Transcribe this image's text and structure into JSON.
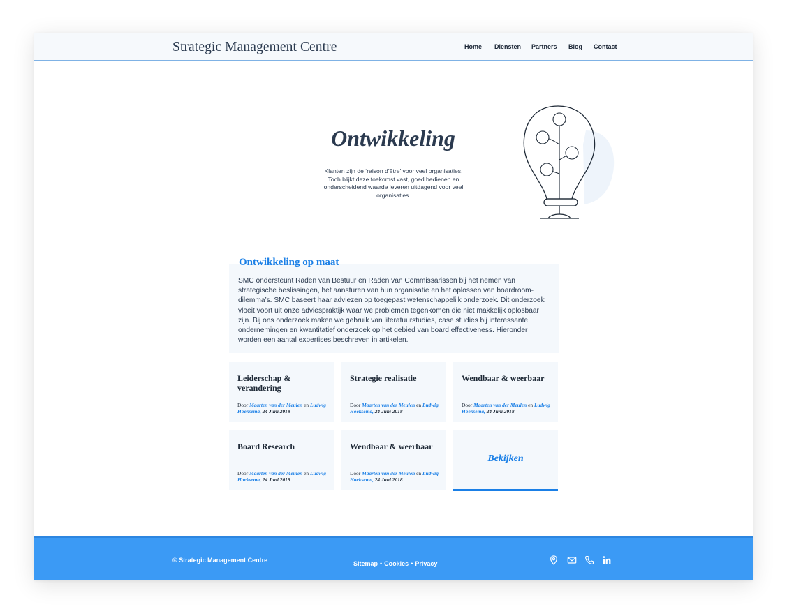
{
  "header": {
    "brand": "Strategic Management Centre",
    "nav": [
      "Home",
      "Diensten",
      "Partners",
      "Blog",
      "Contact"
    ]
  },
  "hero": {
    "title": "Ontwikkeling",
    "text": "Klanten zijn de ‘raison d’être’ voor veel organisaties. Toch blijkt deze toekomst vast, goed bedienen en onderscheidend waarde leveren uitdagend voor veel organisaties.",
    "illustration": "lightbulb-tree-icon"
  },
  "intro": {
    "heading": "Ontwikkeling op maat",
    "text": "SMC ondersteunt Raden van Bestuur en Raden van Commissarissen bij het nemen van strategische beslissingen, het aansturen van hun organisatie en het oplossen van boardroom-dilemma’s. SMC baseert haar adviezen op toegepast wetenschappelijk onderzoek. Dit onderzoek vloeit voort uit onze adviespraktijk waar we problemen tegenkomen die niet makkelijk oplosbaar zijn. Bij ons onderzoek maken we gebruik van literatuurstudies, case studies bij interessante ondernemingen en kwantitatief onderzoek op het gebied van board effectiveness. Hieronder worden een aantal expertises beschreven in artikelen."
  },
  "cards": [
    {
      "title": "Leiderschap & verandering",
      "prefix": "Door",
      "author1": "Maarten van der Meulen",
      "conj": "en",
      "author2": "Ludwig Hoeksema,",
      "date": "24 Juni 2018"
    },
    {
      "title": "Strategie realisatie",
      "prefix": "Door",
      "author1": "Maarten van der Meulen",
      "conj": "en",
      "author2": "Ludwig Hoeksema,",
      "date": "24 Juni 2018"
    },
    {
      "title": "Wendbaar & weerbaar",
      "prefix": "Door",
      "author1": "Maarten van der Meulen",
      "conj": "en",
      "author2": "Ludwig Hoeksema,",
      "date": "24 Juni 2018"
    },
    {
      "title": "Board Research",
      "prefix": "Door",
      "author1": "Maarten van der Meulen",
      "conj": "en",
      "author2": "Ludwig Hoeksema,",
      "date": "24 Juni 2018"
    },
    {
      "title": "Wendbaar & weerbaar",
      "prefix": "Door",
      "author1": "Maarten van der Meulen",
      "conj": "en",
      "author2": "Ludwig Hoeksema,",
      "date": "24 Juni 2018"
    }
  ],
  "cta": {
    "label": "Bekijken"
  },
  "footer": {
    "copyright": "© Strategic Management Centre",
    "links": [
      "Sitemap",
      "Cookies",
      "Privacy"
    ],
    "separator": "•",
    "icons": [
      "location-icon",
      "mail-icon",
      "phone-icon",
      "linkedin-icon"
    ]
  },
  "colors": {
    "accent": "#1a7fe6",
    "footer": "#3b9af5",
    "text": "#2b3a4f",
    "card_bg": "#f4f8fc"
  }
}
